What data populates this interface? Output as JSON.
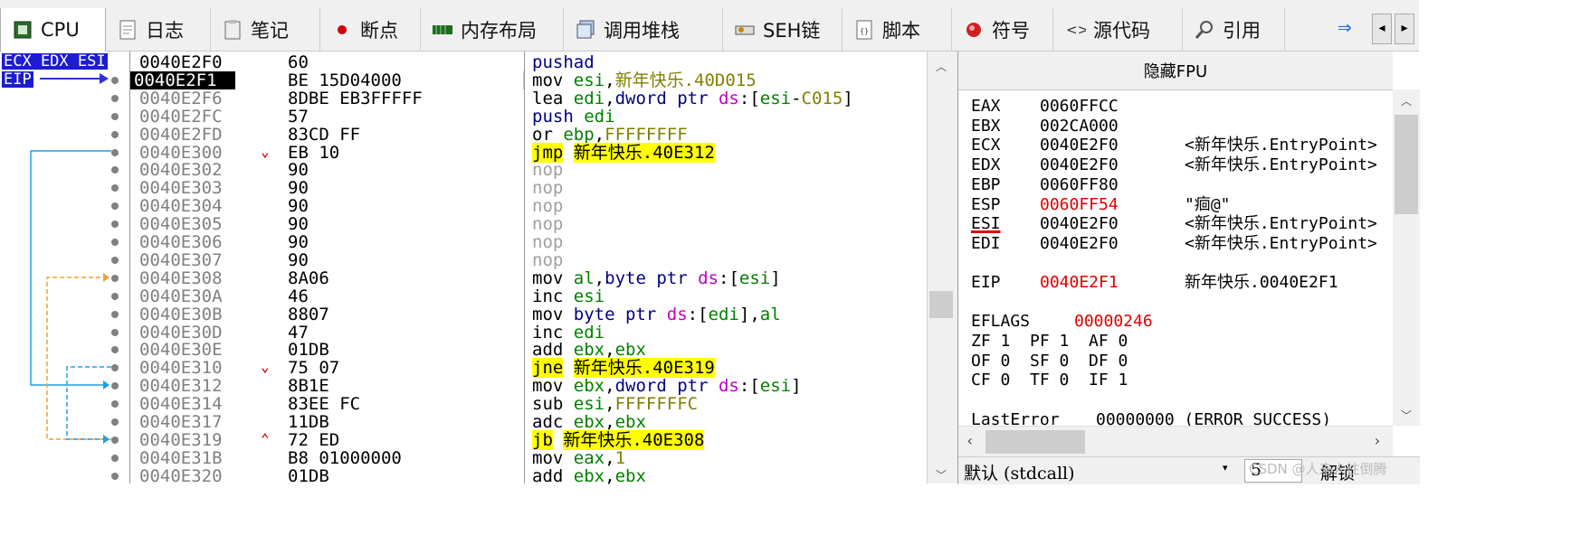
{
  "tabs": [
    {
      "label": "CPU",
      "icon": "cpu-chip-icon"
    },
    {
      "label": "日志",
      "icon": "log-icon"
    },
    {
      "label": "笔记",
      "icon": "notes-icon"
    },
    {
      "label": "断点",
      "icon": "breakpoint-icon"
    },
    {
      "label": "内存布局",
      "icon": "memory-map-icon"
    },
    {
      "label": "调用堆栈",
      "icon": "call-stack-icon"
    },
    {
      "label": "SEH链",
      "icon": "seh-chain-icon"
    },
    {
      "label": "脚本",
      "icon": "script-icon"
    },
    {
      "label": "符号",
      "icon": "symbols-icon"
    },
    {
      "label": "源代码",
      "icon": "source-code-icon"
    },
    {
      "label": "引用",
      "icon": "references-icon"
    }
  ],
  "register_labels": {
    "top": "ECX EDX ESI",
    "eip": "EIP"
  },
  "disasm": [
    {
      "addr": "0040E2F0",
      "bytes": "60",
      "mn": "pushad",
      "ops": ""
    },
    {
      "addr": "0040E2F1",
      "bytes": "BE 15D04000",
      "mn": "mov",
      "ops": "esi,新年快乐.40D015"
    },
    {
      "addr": "0040E2F6",
      "bytes": "8DBE EB3FFFFF",
      "mn": "lea",
      "ops": "edi,dword ptr ds:[esi-C015]"
    },
    {
      "addr": "0040E2FC",
      "bytes": "57",
      "mn": "push",
      "ops": "edi"
    },
    {
      "addr": "0040E2FD",
      "bytes": "83CD FF",
      "mn": "or",
      "ops": "ebp,FFFFFFFF"
    },
    {
      "addr": "0040E300",
      "bytes": "EB 10",
      "mn": "jmp",
      "ops": "新年快乐.40E312"
    },
    {
      "addr": "0040E302",
      "bytes": "90",
      "mn": "nop",
      "ops": ""
    },
    {
      "addr": "0040E303",
      "bytes": "90",
      "mn": "nop",
      "ops": ""
    },
    {
      "addr": "0040E304",
      "bytes": "90",
      "mn": "nop",
      "ops": ""
    },
    {
      "addr": "0040E305",
      "bytes": "90",
      "mn": "nop",
      "ops": ""
    },
    {
      "addr": "0040E306",
      "bytes": "90",
      "mn": "nop",
      "ops": ""
    },
    {
      "addr": "0040E307",
      "bytes": "90",
      "mn": "nop",
      "ops": ""
    },
    {
      "addr": "0040E308",
      "bytes": "8A06",
      "mn": "mov",
      "ops": "al,byte ptr ds:[esi]"
    },
    {
      "addr": "0040E30A",
      "bytes": "46",
      "mn": "inc",
      "ops": "esi"
    },
    {
      "addr": "0040E30B",
      "bytes": "8807",
      "mn": "mov",
      "ops": "byte ptr ds:[edi],al"
    },
    {
      "addr": "0040E30D",
      "bytes": "47",
      "mn": "inc",
      "ops": "edi"
    },
    {
      "addr": "0040E30E",
      "bytes": "01DB",
      "mn": "add",
      "ops": "ebx,ebx"
    },
    {
      "addr": "0040E310",
      "bytes": "75 07",
      "mn": "jne",
      "ops": "新年快乐.40E319"
    },
    {
      "addr": "0040E312",
      "bytes": "8B1E",
      "mn": "mov",
      "ops": "ebx,dword ptr ds:[esi]"
    },
    {
      "addr": "0040E314",
      "bytes": "83EE FC",
      "mn": "sub",
      "ops": "esi,FFFFFFFC"
    },
    {
      "addr": "0040E317",
      "bytes": "11DB",
      "mn": "adc",
      "ops": "ebx,ebx"
    },
    {
      "addr": "0040E319",
      "bytes": "72 ED",
      "mn": "jb",
      "ops": "新年快乐.40E308"
    },
    {
      "addr": "0040E31B",
      "bytes": "B8 01000000",
      "mn": "mov",
      "ops": "eax,1"
    },
    {
      "addr": "0040E320",
      "bytes": "01DB",
      "mn": "add",
      "ops": "ebx,ebx"
    }
  ],
  "fpu_header": "隐藏FPU",
  "registers": [
    {
      "name": "EAX",
      "value": "0060FFCC",
      "comment": ""
    },
    {
      "name": "EBX",
      "value": "002CA000",
      "comment": ""
    },
    {
      "name": "ECX",
      "value": "0040E2F0",
      "comment": "<新年快乐.EntryPoint>"
    },
    {
      "name": "EDX",
      "value": "0040E2F0",
      "comment": "<新年快乐.EntryPoint>"
    },
    {
      "name": "EBP",
      "value": "0060FF80",
      "comment": ""
    },
    {
      "name": "ESP",
      "value": "0060FF54",
      "comment": "\"痐@\"",
      "changed": true
    },
    {
      "name": "ESI",
      "value": "0040E2F0",
      "comment": "<新年快乐.EntryPoint>"
    },
    {
      "name": "EDI",
      "value": "0040E2F0",
      "comment": "<新年快乐.EntryPoint>"
    }
  ],
  "eip_reg": {
    "name": "EIP",
    "value": "0040E2F1",
    "comment": "新年快乐.0040E2F1"
  },
  "eflags": {
    "name": "EFLAGS",
    "value": "00000246"
  },
  "flags_rows": [
    "ZF 1  PF 1  AF 0",
    "OF 0  SF 0  DF 0",
    "CF 0  TF 0  IF 1"
  ],
  "last_error": {
    "name": "LastError",
    "value": "00000000 (ERROR_SUCCESS)"
  },
  "callconv": {
    "value": "默认 (stdcall)",
    "count": "5"
  },
  "unlock_label": "解锁",
  "watermark": "CSDN @人来人往倒腾"
}
